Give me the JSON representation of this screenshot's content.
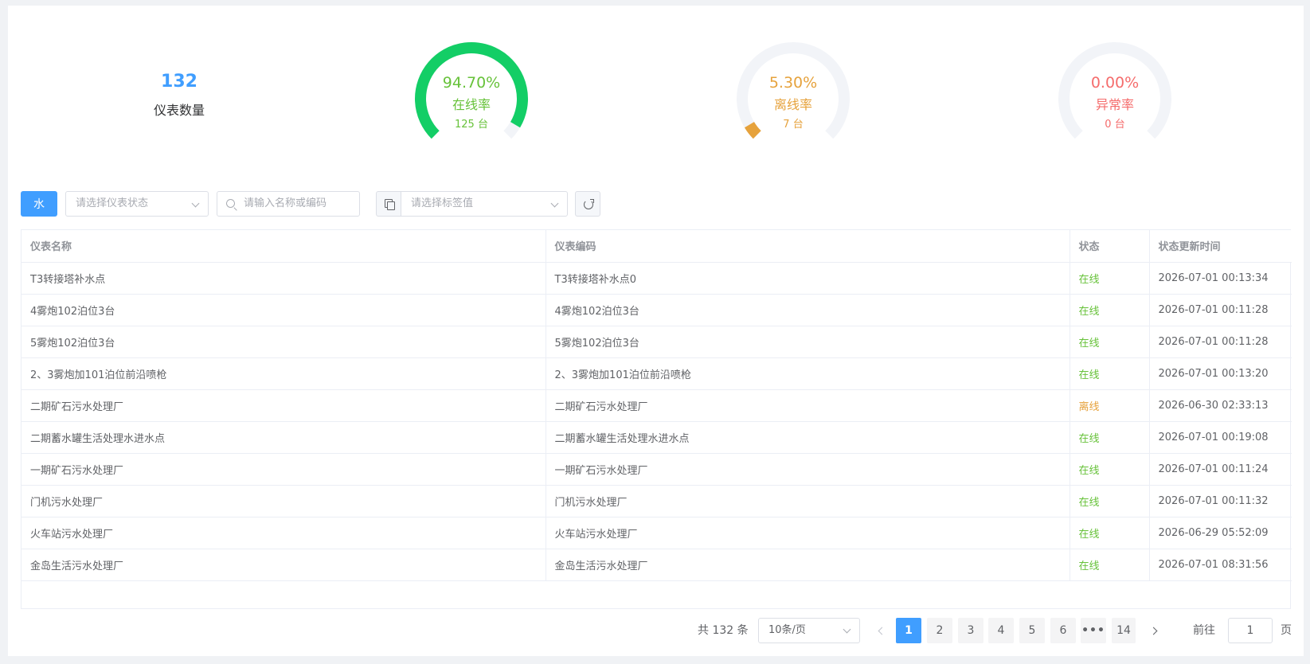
{
  "stats": {
    "meter_count": "132",
    "meter_count_label": "仪表数量",
    "gauges": [
      {
        "percent_text": "94.70%",
        "label": "在线率",
        "units": "125 台",
        "fraction": 0.947,
        "color": "#13ce66",
        "text_color": "#67c23a"
      },
      {
        "percent_text": "5.30%",
        "label": "离线率",
        "units": "7 台",
        "fraction": 0.053,
        "color": "#e6a23c",
        "text_color": "#e6a23c"
      },
      {
        "percent_text": "0.00%",
        "label": "异常率",
        "units": "0 台",
        "fraction": 0.0,
        "color": "#f56c6c",
        "text_color": "#f56c6c"
      }
    ]
  },
  "toolbar": {
    "type_button": "水",
    "status_select_placeholder": "请选择仪表状态",
    "search_placeholder": "请输入名称或编码",
    "tag_select_placeholder": "请选择标签值",
    "copy_icon": "copy-icon",
    "refresh_icon": "refresh-icon"
  },
  "table": {
    "headers": [
      "仪表名称",
      "仪表编码",
      "状态",
      "状态更新时间"
    ],
    "rows": [
      {
        "name": "T3转接塔补水点",
        "code": "T3转接塔补水点0",
        "status": "在线",
        "time": "2026-07-01 00:13:34"
      },
      {
        "name": "4雾炮102泊位3台",
        "code": "4雾炮102泊位3台",
        "status": "在线",
        "time": "2026-07-01 00:11:28"
      },
      {
        "name": "5雾炮102泊位3台",
        "code": "5雾炮102泊位3台",
        "status": "在线",
        "time": "2026-07-01 00:11:28"
      },
      {
        "name": "2、3雾炮加101泊位前沿喷枪",
        "code": "2、3雾炮加101泊位前沿喷枪",
        "status": "在线",
        "time": "2026-07-01 00:13:20"
      },
      {
        "name": "二期矿石污水处理厂",
        "code": "二期矿石污水处理厂",
        "status": "离线",
        "time": "2026-06-30 02:33:13"
      },
      {
        "name": "二期蓄水罐生活处理水进水点",
        "code": "二期蓄水罐生活处理水进水点",
        "status": "在线",
        "time": "2026-07-01 00:19:08"
      },
      {
        "name": "一期矿石污水处理厂",
        "code": "一期矿石污水处理厂",
        "status": "在线",
        "time": "2026-07-01 00:11:24"
      },
      {
        "name": "门机污水处理厂",
        "code": "门机污水处理厂",
        "status": "在线",
        "time": "2026-07-01 00:11:32"
      },
      {
        "name": "火车站污水处理厂",
        "code": "火车站污水处理厂",
        "status": "在线",
        "time": "2026-06-29 05:52:09"
      },
      {
        "name": "金岛生活污水处理厂",
        "code": "金岛生活污水处理厂",
        "status": "在线",
        "time": "2026-07-01 08:31:56"
      }
    ],
    "status_colors": {
      "在线": "#67c23a",
      "离线": "#e6a23c"
    }
  },
  "pagination": {
    "total_text": "共 132 条",
    "page_size": "10条/页",
    "pages": [
      "1",
      "2",
      "3",
      "4",
      "5",
      "6",
      "•••",
      "14"
    ],
    "current_page": "1",
    "goto_label": "前往",
    "goto_value": "1",
    "goto_unit": "页"
  }
}
